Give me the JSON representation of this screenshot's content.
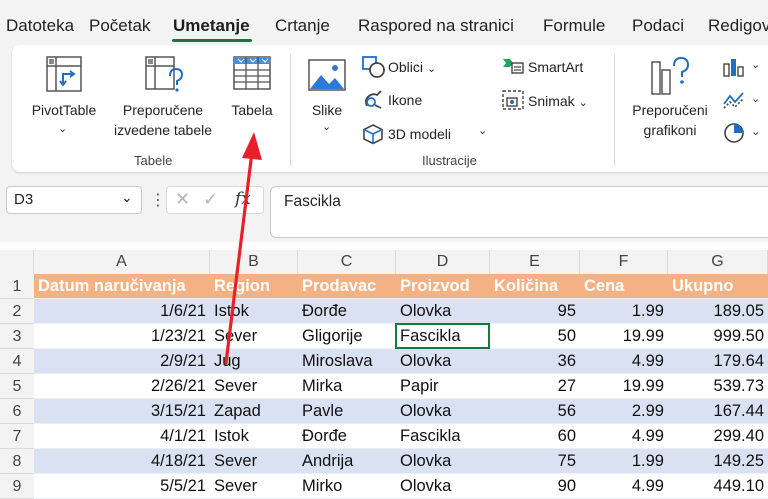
{
  "menu": {
    "tabs": [
      "Datoteka",
      "Početak",
      "Umetanje",
      "Crtanje",
      "Raspored na stranici",
      "Formule",
      "Podaci",
      "Redigov"
    ],
    "active": "Umetanje"
  },
  "ribbon": {
    "pivot_label": "PivotTable",
    "recommended_pivot_line1": "Preporučene",
    "recommended_pivot_line2": "izvedene tabele",
    "table_label": "Tabela",
    "group_tables": "Tabele",
    "pictures_label": "Slike",
    "shapes_label": "Oblici",
    "icons_label": "Ikone",
    "models_label": "3D modeli",
    "smartart_label": "SmartArt",
    "screenshot_label": "Snimak",
    "group_illustrations": "Ilustracije",
    "rec_charts_line1": "Preporučeni",
    "rec_charts_line2": "grafikoni"
  },
  "formula_bar": {
    "name_box": "D3",
    "fx_symbol": "fx",
    "formula": "Fascikla"
  },
  "sheet": {
    "columns": [
      "A",
      "B",
      "C",
      "D",
      "E",
      "F",
      "G"
    ],
    "rows": [
      "1",
      "2",
      "3",
      "4",
      "5",
      "6",
      "7",
      "8",
      "9"
    ],
    "header": [
      "Datum naručivanja",
      "Region",
      "Prodavac",
      "Proizvod",
      "Količina",
      "Cena",
      "Ukupno"
    ],
    "data": [
      [
        "1/6/21",
        "Istok",
        "Đorđe",
        "Olovka",
        "95",
        "1.99",
        "189.05"
      ],
      [
        "1/23/21",
        "Sever",
        "Gligorije",
        "Fascikla",
        "50",
        "19.99",
        "999.50"
      ],
      [
        "2/9/21",
        "Jug",
        "Miroslava",
        "Olovka",
        "36",
        "4.99",
        "179.64"
      ],
      [
        "2/26/21",
        "Sever",
        "Mirka",
        "Papir",
        "27",
        "19.99",
        "539.73"
      ],
      [
        "3/15/21",
        "Zapad",
        "Pavle",
        "Olovka",
        "56",
        "2.99",
        "167.44"
      ],
      [
        "4/1/21",
        "Istok",
        "Đorđe",
        "Fascikla",
        "60",
        "4.99",
        "299.40"
      ],
      [
        "4/18/21",
        "Sever",
        "Andrija",
        "Olovka",
        "75",
        "1.99",
        "149.25"
      ],
      [
        "5/5/21",
        "Sever",
        "Mirko",
        "Olovka",
        "90",
        "4.99",
        "449.10"
      ]
    ],
    "header_color": "#f4b183",
    "band_color": "#d9e1f2"
  },
  "annotation": {
    "arrow_color": "#e8202a"
  }
}
